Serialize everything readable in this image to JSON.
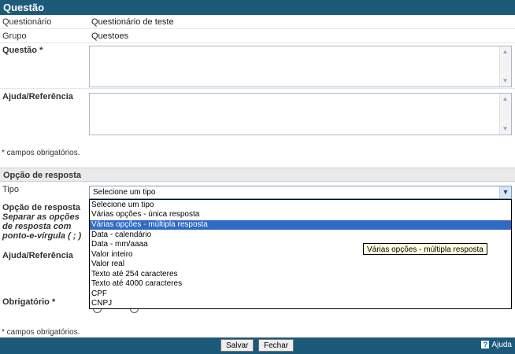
{
  "header": {
    "title": "Questão"
  },
  "form": {
    "questionario_label": "Questionário",
    "questionario_value": "Questionário de teste",
    "grupo_label": "Grupo",
    "grupo_value": "Questoes",
    "questao_label": "Questão *",
    "ajuda_label": "Ajuda/Referência",
    "required_note": "* campos obrigatórios."
  },
  "option_section": {
    "title": "Opção de resposta",
    "tipo_label": "Tipo",
    "tipo_selected": "Selecione um tipo",
    "opcao_label": "Opção de resposta",
    "opcao_hint": "Separar as opções de resposta com ponto-e-vírgula ( ; )",
    "ajuda_label": "Ajuda/Referência",
    "obrigatorio_label": "Obrigatório *",
    "required_note": "* campos obrigatórios.",
    "dropdown_options": [
      "Selecione um tipo",
      "Várias opções - única resposta",
      "Várias opções - múltipla resposta",
      "Data - calendário",
      "Data - mm/aaaa",
      "Valor inteiro",
      "Valor real",
      "Texto até 254 caracteres",
      "Texto até 4000 caracteres",
      "CPF",
      "CNPJ"
    ],
    "highlighted_option": "Várias opções - múltipla resposta",
    "tooltip": "Várias opções - múltipla resposta"
  },
  "footer": {
    "save_label": "Salvar",
    "close_label": "Fechar",
    "help_label": "Ajuda",
    "help_icon": "?"
  },
  "colors": {
    "header_bg": "#1d5a7a",
    "highlight": "#316ac5"
  }
}
